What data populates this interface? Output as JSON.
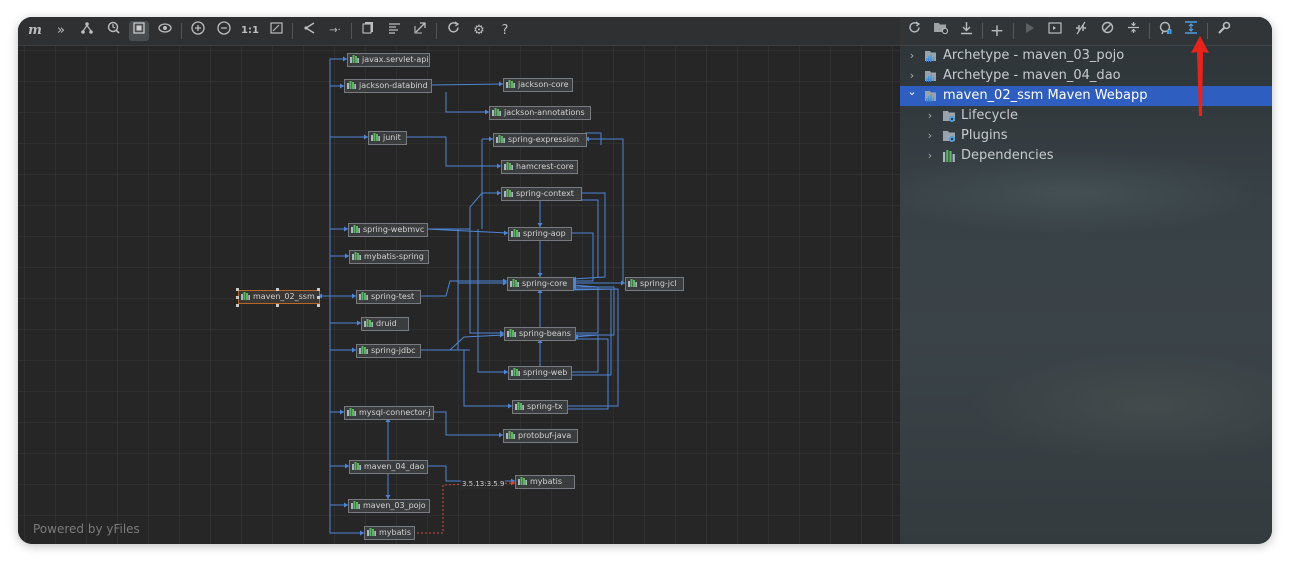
{
  "diagram": {
    "toolbar_icons": [
      "maven-logo-icon",
      "show-dependencies-icon",
      "hierarchy-icon",
      "fit-content-icon",
      "select-mode-icon",
      "eye-icon",
      "zoom-in-icon",
      "zoom-out-icon",
      "actual-size-icon",
      "fit-window-icon",
      "layout-icon",
      "export-icon",
      "copy-icon",
      "align-icon",
      "expand-icon",
      "refresh-icon",
      "settings-icon",
      "help-icon"
    ],
    "actual_size_label": "1:1",
    "help_label": "?",
    "powered_by": "Powered by yFiles",
    "version_conflict_label": "3.5.13:3.5.9",
    "nodes": {
      "root": "maven_02_ssm",
      "servlet": "javax.servlet-api",
      "jdatabind": "jackson-databind",
      "jcore": "jackson-core",
      "jannot": "jackson-annotations",
      "junit": "junit",
      "sexpr": "spring-expression",
      "hamcrest": "hamcrest-core",
      "sctx": "spring-context",
      "swebmvc": "spring-webmvc",
      "saop": "spring-aop",
      "mybspring": "mybatis-spring",
      "score": "spring-core",
      "sjcl": "spring-jcl",
      "stest": "spring-test",
      "druid": "druid",
      "sbeans": "spring-beans",
      "sjdbc": "spring-jdbc",
      "sweb": "spring-web",
      "stx": "spring-tx",
      "mysql": "mysql-connector-j",
      "protobuf": "protobuf-java",
      "m04": "maven_04_dao",
      "mybatis1": "mybatis",
      "m03": "maven_03_pojo",
      "mybatis2": "mybatis"
    }
  },
  "maven": {
    "toolbar_icons": [
      "reload-icon",
      "add-folder-icon",
      "download-icon",
      "plus-icon",
      "run-icon",
      "execute-goal-icon",
      "toggle-offline-icon",
      "skip-tests-icon",
      "collapse-icon",
      "analyze-dependencies-icon",
      "show-diagram-icon",
      "settings-wrench-icon"
    ],
    "plus_label": "+",
    "tree": [
      {
        "label": "Archetype - maven_03_pojo",
        "expanded": false,
        "selected": false,
        "level": 0,
        "icon": "maven-module-icon"
      },
      {
        "label": "Archetype - maven_04_dao",
        "expanded": false,
        "selected": false,
        "level": 0,
        "icon": "maven-module-icon"
      },
      {
        "label": "maven_02_ssm Maven Webapp",
        "expanded": true,
        "selected": true,
        "level": 0,
        "icon": "maven-module-icon"
      },
      {
        "label": "Lifecycle",
        "expanded": false,
        "selected": false,
        "level": 1,
        "icon": "lifecycle-folder-icon"
      },
      {
        "label": "Plugins",
        "expanded": false,
        "selected": false,
        "level": 1,
        "icon": "plugins-folder-icon"
      },
      {
        "label": "Dependencies",
        "expanded": false,
        "selected": false,
        "level": 1,
        "icon": "dependencies-icon"
      }
    ]
  },
  "colors": {
    "selection": "#2e5ebf",
    "edge": "#4f86d6",
    "conflict_edge": "#d44a3a",
    "root_border": "#b5682a",
    "annotation_arrow": "#e8231c"
  }
}
